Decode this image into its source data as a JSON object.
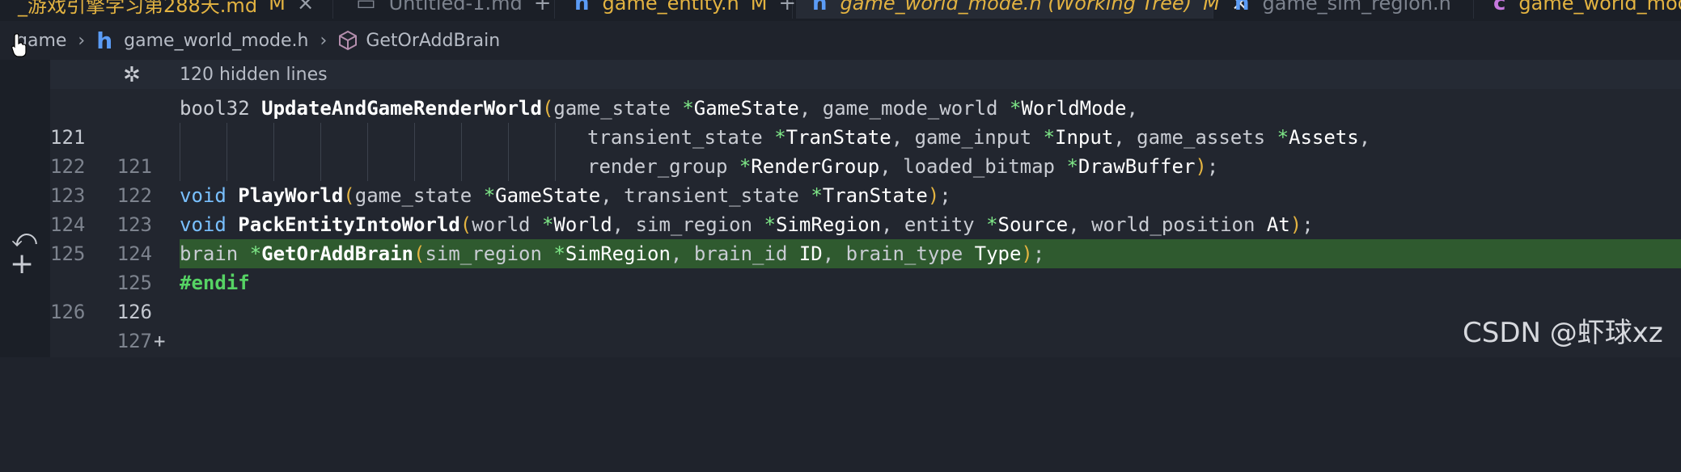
{
  "tabs": [
    {
      "label": "_游戏引擎学习第288天.md",
      "status": "M",
      "active": false
    },
    {
      "label": "Untitled-1.md",
      "status": "",
      "active": false
    },
    {
      "label": "game_entity.h",
      "status": "M",
      "active": false
    },
    {
      "label": "game_world_mode.h (Working Tree)",
      "status": "M",
      "active": true
    },
    {
      "label": "game_sim_region.h",
      "status": "",
      "active": false
    },
    {
      "label": "game_world_mode",
      "status": "",
      "active": false
    }
  ],
  "breadcrumb": {
    "root": "game",
    "file": "game_world_mode.h",
    "symbol": "GetOrAddBrain"
  },
  "hidden_lines_label": "120 hidden lines",
  "lines": [
    {
      "old": "121",
      "new": "121"
    },
    {
      "old": "122",
      "new": "122"
    },
    {
      "old": "123",
      "new": "123"
    },
    {
      "old": "124",
      "new": "124"
    },
    {
      "old": "125",
      "new": "125"
    },
    {
      "old": "",
      "new": "126",
      "added": true
    },
    {
      "old": "126",
      "new": "127"
    }
  ],
  "code": {
    "l121": {
      "ret": "bool32",
      "fn": "UpdateAndGameRenderWorld",
      "p1t": "game_state",
      "p1": "GameState",
      "p2t": "game_mode_world",
      "p2": "WorldMode"
    },
    "l122": {
      "p1t": "transient_state",
      "p1": "TranState",
      "p2t": "game_input",
      "p2": "Input",
      "p3t": "game_assets",
      "p3": "Assets"
    },
    "l123": {
      "p1t": "render_group",
      "p1": "RenderGroup",
      "p2t": "loaded_bitmap",
      "p2": "DrawBuffer"
    },
    "l124": {
      "ret": "void",
      "fn": "PlayWorld",
      "p1t": "game_state",
      "p1": "GameState",
      "p2t": "transient_state",
      "p2": "TranState"
    },
    "l125": {
      "ret": "void",
      "fn": "PackEntityIntoWorld",
      "p1t": "world",
      "p1": "World",
      "p2t": "sim_region",
      "p2": "SimRegion",
      "p3t": "entity",
      "p3": "Source",
      "p4t": "world_position",
      "p4": "At"
    },
    "l126": {
      "ret": "brain",
      "fn": "GetOrAddBrain",
      "p1t": "sim_region",
      "p1": "SimRegion",
      "p2t": "brain_id",
      "p2": "ID",
      "p3t": "brain_type",
      "p3": "Type"
    },
    "l127": {
      "directive": "#endif"
    }
  },
  "watermark": "CSDN @虾球xz",
  "colors": {
    "accent_yellow": "#e3b341",
    "added_line": "#2f5a2f",
    "keyword": "#79c0ff",
    "pointer": "#7ee787",
    "preprocessor": "#56d364"
  }
}
